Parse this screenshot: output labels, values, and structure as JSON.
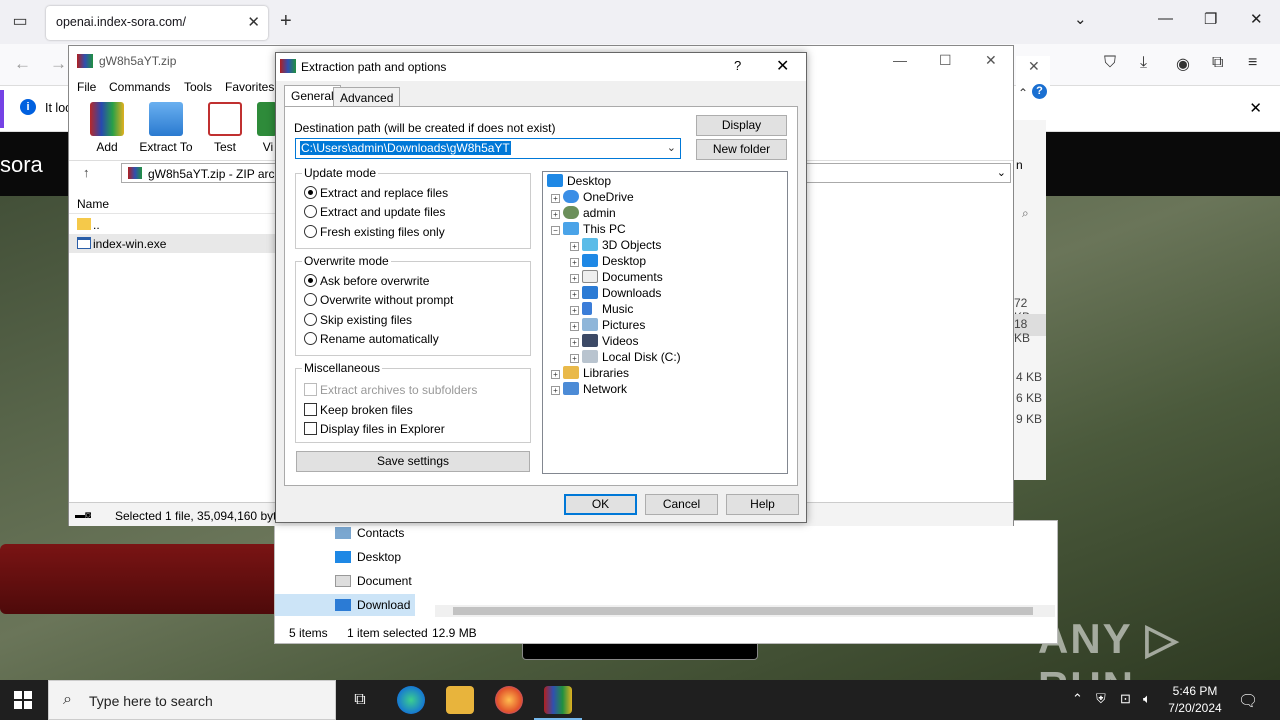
{
  "browser": {
    "tab_title": "openai.index-sora.com/",
    "notification_text": "It loc"
  },
  "page": {
    "logo_text": "sora",
    "watermark": "ANY ▷ RUN"
  },
  "winrar": {
    "title": "gW8h5aYT.zip",
    "menu": [
      "File",
      "Commands",
      "Tools",
      "Favorites"
    ],
    "toolbar": [
      {
        "label": "Add",
        "icon": "add-archive-icon"
      },
      {
        "label": "Extract To",
        "icon": "extract-to-icon"
      },
      {
        "label": "Test",
        "icon": "test-icon"
      },
      {
        "label": "Vi",
        "icon": "view-icon"
      }
    ],
    "path_text": "gW8h5aYT.zip - ZIP arch",
    "column_name": "Name",
    "files": [
      {
        "name": "..",
        "icon": "folder-icon"
      },
      {
        "name": "index-win.exe",
        "icon": "exe-icon"
      }
    ],
    "status_text": "Selected 1 file, 35,094,160 byte",
    "right_partial": "n"
  },
  "background_sizes": [
    "72 KB",
    "18 KB",
    "4 KB",
    "6 KB",
    "9 KB"
  ],
  "explorer": {
    "nav": [
      "Contacts",
      "Desktop",
      "Document",
      "Download"
    ],
    "status_items": "5 items",
    "status_selected": "1 item selected",
    "status_size": "12.9 MB"
  },
  "dialog": {
    "title": "Extraction path and options",
    "help_label": "?",
    "tabs": [
      "General",
      "Advanced"
    ],
    "dest_label": "Destination path (will be created if does not exist)",
    "dest_value": "C:\\Users\\admin\\Downloads\\gW8h5aYT",
    "display_btn": "Display",
    "new_folder_btn": "New folder",
    "update_mode": {
      "caption": "Update mode",
      "options": [
        "Extract and replace files",
        "Extract and update files",
        "Fresh existing files only"
      ],
      "selected": 0
    },
    "overwrite_mode": {
      "caption": "Overwrite mode",
      "options": [
        "Ask before overwrite",
        "Overwrite without prompt",
        "Skip existing files",
        "Rename automatically"
      ],
      "selected": 0
    },
    "misc": {
      "caption": "Miscellaneous",
      "options": [
        "Extract archives to subfolders",
        "Keep broken files",
        "Display files in Explorer"
      ]
    },
    "save_settings": "Save settings",
    "tree": [
      {
        "label": "Desktop",
        "level": 0,
        "icon": "desktop-icon"
      },
      {
        "label": "OneDrive",
        "level": 1,
        "icon": "onedrive-icon"
      },
      {
        "label": "admin",
        "level": 1,
        "icon": "user-icon"
      },
      {
        "label": "This PC",
        "level": 1,
        "icon": "pc-icon"
      },
      {
        "label": "3D Objects",
        "level": 2,
        "icon": "3d-objects-icon"
      },
      {
        "label": "Desktop",
        "level": 2,
        "icon": "desktop-icon"
      },
      {
        "label": "Documents",
        "level": 2,
        "icon": "documents-icon"
      },
      {
        "label": "Downloads",
        "level": 2,
        "icon": "downloads-icon"
      },
      {
        "label": "Music",
        "level": 2,
        "icon": "music-icon"
      },
      {
        "label": "Pictures",
        "level": 2,
        "icon": "pictures-icon"
      },
      {
        "label": "Videos",
        "level": 2,
        "icon": "videos-icon"
      },
      {
        "label": "Local Disk (C:)",
        "level": 2,
        "icon": "disk-icon"
      },
      {
        "label": "Libraries",
        "level": 1,
        "icon": "libraries-icon"
      },
      {
        "label": "Network",
        "level": 1,
        "icon": "network-icon"
      }
    ],
    "ok": "OK",
    "cancel": "Cancel",
    "help": "Help"
  },
  "taskbar": {
    "search_placeholder": "Type here to search",
    "time": "5:46 PM",
    "date": "7/20/2024"
  }
}
